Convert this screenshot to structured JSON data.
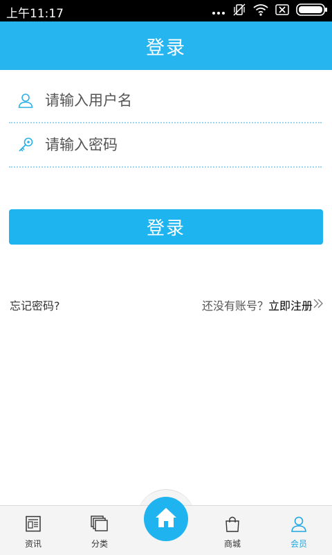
{
  "status_bar": {
    "time": "上午11:17"
  },
  "header": {
    "title": "登录"
  },
  "form": {
    "username": {
      "placeholder": "请输入用户名",
      "value": ""
    },
    "password": {
      "placeholder": "请输入密码",
      "value": ""
    },
    "login_label": "登录"
  },
  "links": {
    "forgot": "忘记密码?",
    "no_account": "还没有账号？",
    "register": "立即注册"
  },
  "tabbar": {
    "items": [
      {
        "label": "资讯",
        "icon": "news-icon"
      },
      {
        "label": "分类",
        "icon": "category-icon"
      },
      {
        "label": "",
        "icon": "home-icon"
      },
      {
        "label": "商城",
        "icon": "shopping-bag-icon"
      },
      {
        "label": "会员",
        "icon": "member-icon"
      }
    ],
    "active_index": 4
  },
  "colors": {
    "accent": "#27b5ef",
    "divider": "#9bd6ee",
    "active_tab": "#1fa7e2"
  }
}
